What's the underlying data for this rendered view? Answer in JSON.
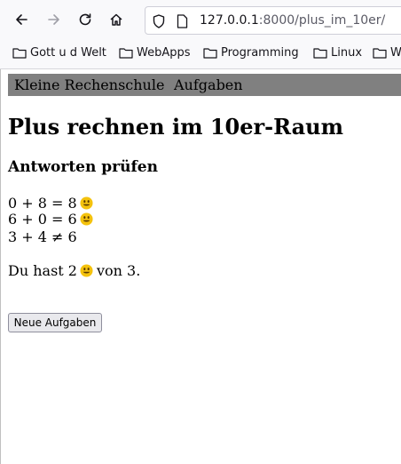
{
  "browser": {
    "url_host": "127.0.0.1",
    "url_path": ":8000/plus_im_10er/",
    "bookmarks": [
      "Gott u d Welt",
      "WebApps",
      "Programming",
      "Linux",
      "W"
    ]
  },
  "nav": {
    "brand": "Kleine Rechenschule",
    "link": "Aufgaben"
  },
  "page": {
    "title": "Plus rechnen im 10er-Raum",
    "subtitle": "Antworten prüfen",
    "results": [
      {
        "expr": "0 + 8 = 8",
        "correct": true
      },
      {
        "expr": "6 + 0 = 6",
        "correct": true
      },
      {
        "expr": "3 + 4 ≠ 6",
        "correct": false
      }
    ],
    "summary_prefix": "Du hast 2",
    "summary_suffix": "von 3.",
    "new_tasks_button": "Neue Aufgaben"
  },
  "icons": {
    "smiley": "smiley-icon",
    "folder": "folder-icon"
  }
}
